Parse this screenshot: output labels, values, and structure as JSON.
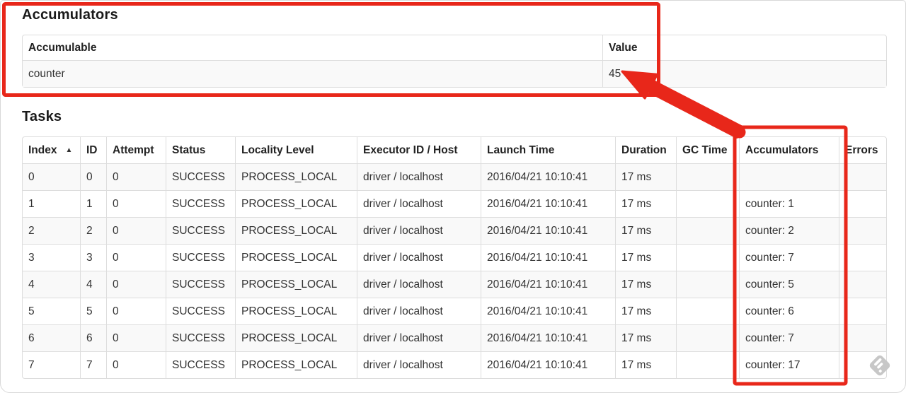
{
  "accumulators_section": {
    "title": "Accumulators",
    "table": {
      "columns": [
        {
          "key": "accumulable",
          "label": "Accumulable"
        },
        {
          "key": "value",
          "label": "Value"
        }
      ],
      "rows": [
        {
          "accumulable": "counter",
          "value": "45"
        }
      ]
    }
  },
  "tasks_section": {
    "title": "Tasks",
    "table": {
      "sort_indicator": "▲",
      "sorted_column": "index",
      "columns": [
        {
          "key": "index",
          "label": "Index"
        },
        {
          "key": "id",
          "label": "ID"
        },
        {
          "key": "attempt",
          "label": "Attempt"
        },
        {
          "key": "status",
          "label": "Status"
        },
        {
          "key": "locality_level",
          "label": "Locality Level"
        },
        {
          "key": "executor_id_host",
          "label": "Executor ID / Host"
        },
        {
          "key": "launch_time",
          "label": "Launch Time"
        },
        {
          "key": "duration",
          "label": "Duration"
        },
        {
          "key": "gc_time",
          "label": "GC Time"
        },
        {
          "key": "accumulators",
          "label": "Accumulators"
        },
        {
          "key": "errors",
          "label": "Errors"
        }
      ],
      "rows": [
        {
          "index": "0",
          "id": "0",
          "attempt": "0",
          "status": "SUCCESS",
          "locality_level": "PROCESS_LOCAL",
          "executor_id_host": "driver / localhost",
          "launch_time": "2016/04/21 10:10:41",
          "duration": "17 ms",
          "gc_time": "",
          "accumulators": "",
          "errors": ""
        },
        {
          "index": "1",
          "id": "1",
          "attempt": "0",
          "status": "SUCCESS",
          "locality_level": "PROCESS_LOCAL",
          "executor_id_host": "driver / localhost",
          "launch_time": "2016/04/21 10:10:41",
          "duration": "17 ms",
          "gc_time": "",
          "accumulators": "counter: 1",
          "errors": ""
        },
        {
          "index": "2",
          "id": "2",
          "attempt": "0",
          "status": "SUCCESS",
          "locality_level": "PROCESS_LOCAL",
          "executor_id_host": "driver / localhost",
          "launch_time": "2016/04/21 10:10:41",
          "duration": "17 ms",
          "gc_time": "",
          "accumulators": "counter: 2",
          "errors": ""
        },
        {
          "index": "3",
          "id": "3",
          "attempt": "0",
          "status": "SUCCESS",
          "locality_level": "PROCESS_LOCAL",
          "executor_id_host": "driver / localhost",
          "launch_time": "2016/04/21 10:10:41",
          "duration": "17 ms",
          "gc_time": "",
          "accumulators": "counter: 7",
          "errors": ""
        },
        {
          "index": "4",
          "id": "4",
          "attempt": "0",
          "status": "SUCCESS",
          "locality_level": "PROCESS_LOCAL",
          "executor_id_host": "driver / localhost",
          "launch_time": "2016/04/21 10:10:41",
          "duration": "17 ms",
          "gc_time": "",
          "accumulators": "counter: 5",
          "errors": ""
        },
        {
          "index": "5",
          "id": "5",
          "attempt": "0",
          "status": "SUCCESS",
          "locality_level": "PROCESS_LOCAL",
          "executor_id_host": "driver / localhost",
          "launch_time": "2016/04/21 10:10:41",
          "duration": "17 ms",
          "gc_time": "",
          "accumulators": "counter: 6",
          "errors": ""
        },
        {
          "index": "6",
          "id": "6",
          "attempt": "0",
          "status": "SUCCESS",
          "locality_level": "PROCESS_LOCAL",
          "executor_id_host": "driver / localhost",
          "launch_time": "2016/04/21 10:10:41",
          "duration": "17 ms",
          "gc_time": "",
          "accumulators": "counter: 7",
          "errors": ""
        },
        {
          "index": "7",
          "id": "7",
          "attempt": "0",
          "status": "SUCCESS",
          "locality_level": "PROCESS_LOCAL",
          "executor_id_host": "driver / localhost",
          "launch_time": "2016/04/21 10:10:41",
          "duration": "17 ms",
          "gc_time": "",
          "accumulators": "counter: 17",
          "errors": ""
        }
      ]
    }
  },
  "annotations": {
    "color": "#e8271a",
    "box1_target": "accumulators summary",
    "box2_target": "tasks accumulators column",
    "arrow_target": "value 45"
  },
  "watermark": {
    "icon": "skitch-logo",
    "color": "#c7c7c7"
  }
}
